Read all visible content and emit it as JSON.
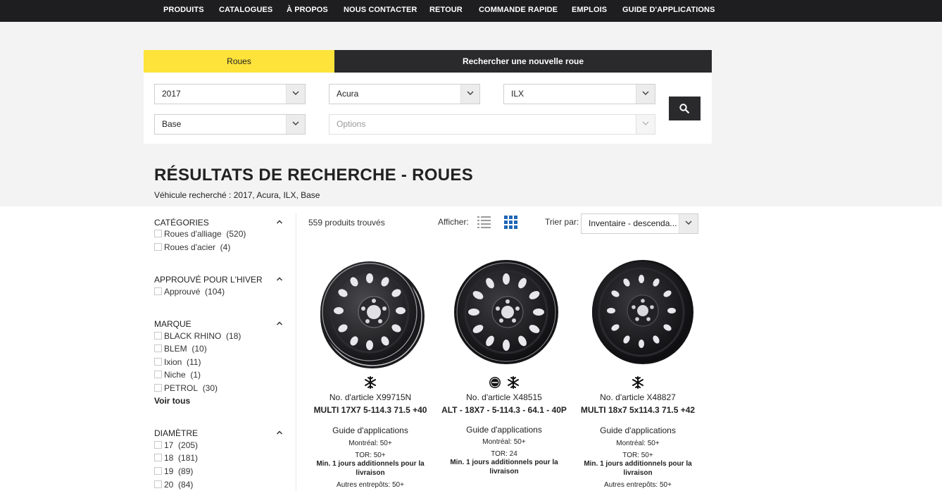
{
  "nav": [
    "PRODUITS",
    "CATALOGUES",
    "À PROPOS",
    "NOUS CONTACTER",
    "RETOUR",
    "COMMANDE RAPIDE",
    "EMPLOIS",
    "GUIDE D'APPLICATIONS"
  ],
  "tabs": {
    "active": "Roues",
    "other": "Rechercher une nouvelle roue"
  },
  "search": {
    "year": "2017",
    "make": "Acura",
    "model": "ILX",
    "trim": "Base",
    "options_placeholder": "Options"
  },
  "results": {
    "title": "RÉSULTATS DE RECHERCHE - ROUES",
    "vehicle": "Véhicule recherché : 2017, Acura, ILX, Base",
    "count": "559 produits trouvés",
    "show_label": "Afficher:",
    "sort_label": "Trier par:",
    "sort_value": "Inventaire - descenda..."
  },
  "filters": {
    "categories": {
      "title": "CATÉGORIES",
      "options": [
        {
          "label": "Roues d'alliage",
          "count": "(520)"
        },
        {
          "label": "Roues d'acier",
          "count": "(4)"
        }
      ]
    },
    "winter": {
      "title": "APPROUVÉ POUR L'HIVER",
      "options": [
        {
          "label": "Approuvé",
          "count": "(104)"
        }
      ]
    },
    "brand": {
      "title": "MARQUE",
      "options": [
        {
          "label": "BLACK RHINO",
          "count": "(18)"
        },
        {
          "label": "BLEM",
          "count": "(10)"
        },
        {
          "label": "Ixion",
          "count": "(11)"
        },
        {
          "label": "Niche",
          "count": "(1)"
        },
        {
          "label": "PETROL",
          "count": "(30)"
        }
      ],
      "see_all": "Voir tous"
    },
    "diameter": {
      "title": "DIAMÈTRE",
      "options": [
        {
          "label": "17",
          "count": "(205)"
        },
        {
          "label": "18",
          "count": "(181)"
        },
        {
          "label": "19",
          "count": "(89)"
        },
        {
          "label": "20",
          "count": "(84)"
        }
      ]
    }
  },
  "products": [
    {
      "part": "No. d'article X99715N",
      "name": "MULTI 17X7 5-114.3 71.5 +40",
      "guide": "Guide d'applications",
      "stock1": "Montréal: 50+",
      "stock2": "TOR: 50+",
      "delivery": "Min. 1 jours additionnels pour la livraison",
      "stock3": "Autres entrepôts: 50+",
      "badges": [
        "snowflake-icon"
      ]
    },
    {
      "part": "No. d'article X48515",
      "name": "ALT - 18X7 - 5-114.3 - 64.1 - 40P",
      "guide": "Guide d'applications",
      "stock1": "Montréal: 50+",
      "stock2": "TOR: 24",
      "delivery": "Min. 1 jours additionnels pour la livraison",
      "stock3": "",
      "badges": [
        "hub-centric-icon",
        "snowflake-icon"
      ]
    },
    {
      "part": "No. d'article X48827",
      "name": "MULTI 18x7 5x114.3 71.5 +42",
      "guide": "Guide d'applications",
      "stock1": "Montréal: 50+",
      "stock2": "TOR: 50+",
      "delivery": "Min. 1 jours additionnels pour la livraison",
      "stock3": "Autres entrepôts: 50+",
      "badges": [
        "snowflake-icon"
      ]
    }
  ],
  "colors": {
    "nav_bg": "#1e1e20",
    "accent_yellow": "#fde33a",
    "grid_icon_blue": "#1f66b5",
    "band_bg": "#f3f3f3"
  }
}
